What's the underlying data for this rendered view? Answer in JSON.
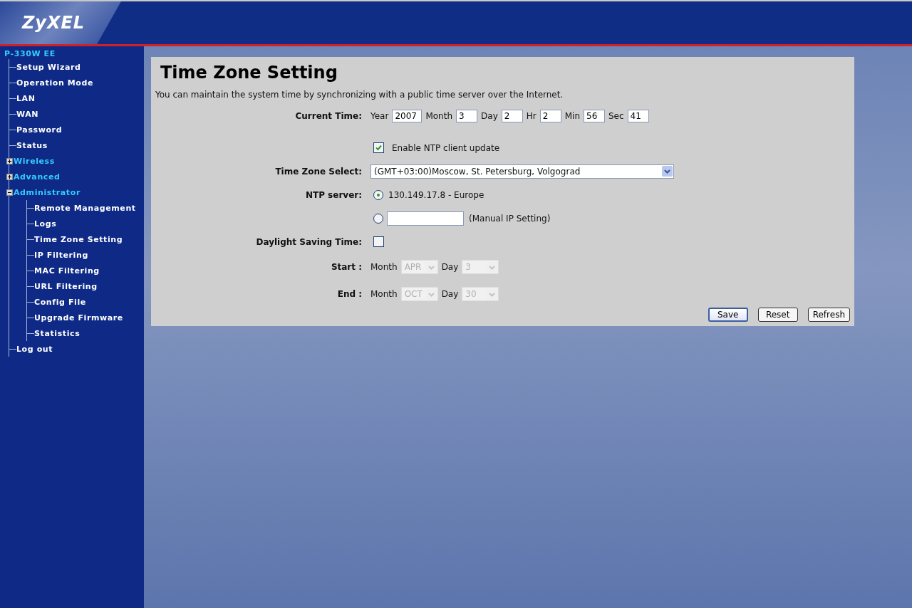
{
  "brand": {
    "logo": "ZyXEL"
  },
  "sidebar": {
    "device": "P-330W EE",
    "items": [
      {
        "kind": "page",
        "label": "Setup Wizard"
      },
      {
        "kind": "page",
        "label": "Operation Mode"
      },
      {
        "kind": "page",
        "label": "LAN"
      },
      {
        "kind": "page",
        "label": "WAN"
      },
      {
        "kind": "page",
        "label": "Password"
      },
      {
        "kind": "page",
        "label": "Status"
      },
      {
        "kind": "folder",
        "label": "Wireless",
        "expanded": false
      },
      {
        "kind": "folder",
        "label": "Advanced",
        "expanded": false
      },
      {
        "kind": "folder",
        "label": "Administrator",
        "expanded": true,
        "children": [
          {
            "label": "Remote Management"
          },
          {
            "label": "Logs"
          },
          {
            "label": "Time Zone Setting"
          },
          {
            "label": "IP Filtering"
          },
          {
            "label": "MAC Filtering"
          },
          {
            "label": "URL Filtering"
          },
          {
            "label": "Config File"
          },
          {
            "label": "Upgrade Firmware"
          },
          {
            "label": "Statistics"
          }
        ]
      },
      {
        "kind": "page",
        "label": "Log out"
      }
    ]
  },
  "form": {
    "title": "Time Zone Setting",
    "description": "You can maintain the system time by synchronizing with a public time server over the Internet.",
    "current_time": {
      "label": "Current Time:",
      "parts": [
        {
          "unit": "Year",
          "value": "2007"
        },
        {
          "unit": "Month",
          "value": "3"
        },
        {
          "unit": "Day",
          "value": "2"
        },
        {
          "unit": "Hr",
          "value": "2"
        },
        {
          "unit": "Min",
          "value": "56"
        },
        {
          "unit": "Sec",
          "value": "41"
        }
      ]
    },
    "ntp_update": {
      "label": "Enable NTP client update",
      "checked": true
    },
    "time_zone": {
      "label": "Time Zone Select:",
      "value": "(GMT+03:00)Moscow, St. Petersburg, Volgograd"
    },
    "ntp_server": {
      "label": "NTP server:",
      "options": [
        {
          "kind": "preset",
          "label": "130.149.17.8 - Europe",
          "selected": true
        },
        {
          "kind": "manual",
          "note": "(Manual IP Setting)",
          "selected": false
        }
      ]
    },
    "daylight": {
      "label": "Daylight Saving Time:",
      "checked": false
    },
    "ranges": [
      {
        "label": "Start :",
        "month_label": "Month",
        "month": "APR",
        "day_label": "Day",
        "day": "3",
        "disabled": true
      },
      {
        "label": "End :",
        "month_label": "Month",
        "month": "OCT",
        "day_label": "Day",
        "day": "30",
        "disabled": true
      }
    ],
    "buttons": [
      {
        "label": "Save",
        "default": true
      },
      {
        "label": "Reset",
        "default": false
      },
      {
        "label": "Refresh",
        "default": false
      }
    ]
  }
}
